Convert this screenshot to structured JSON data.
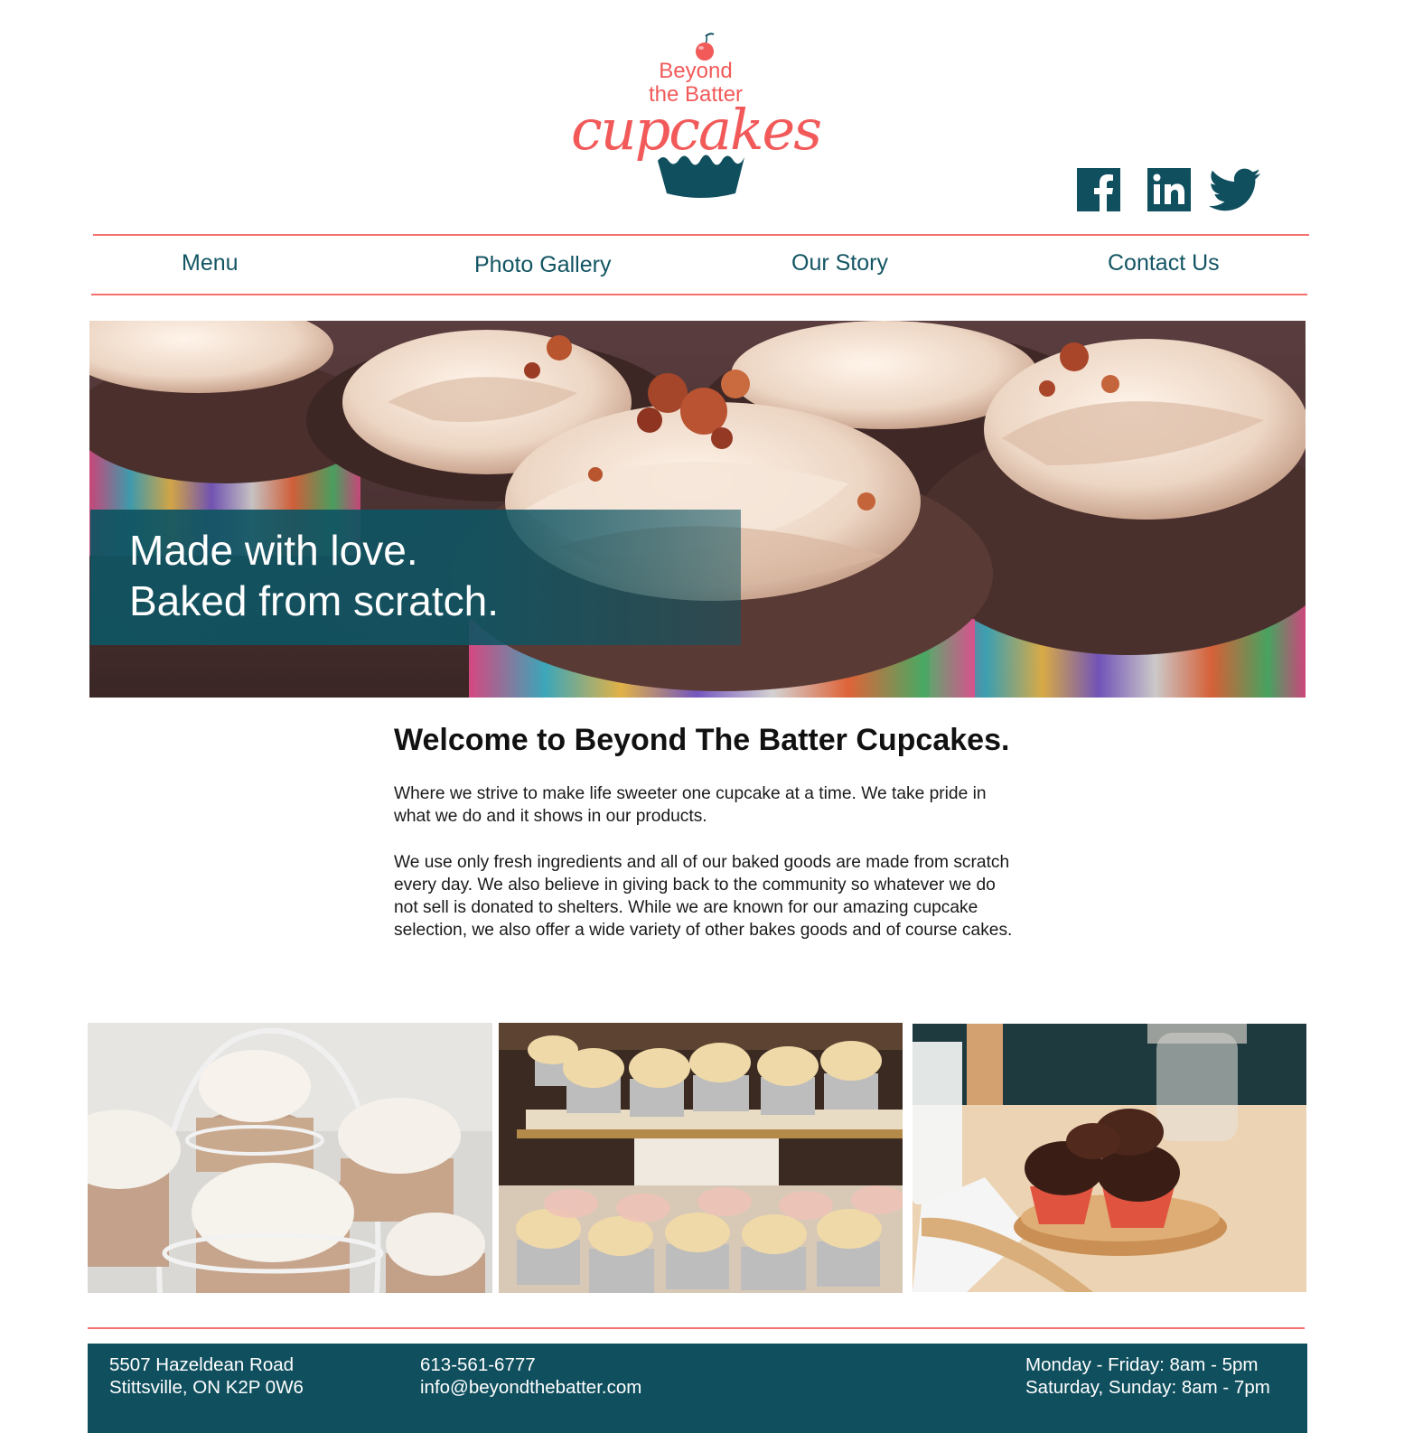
{
  "brand": {
    "logo_line1": "Beyond",
    "logo_line2": "the Batter",
    "logo_script": "cupcakes",
    "primary_color": "#f25a5a",
    "accent_color": "#135563"
  },
  "social": [
    {
      "icon": "facebook-icon"
    },
    {
      "icon": "linkedin-icon"
    },
    {
      "icon": "twitter-icon"
    }
  ],
  "nav": {
    "items": [
      {
        "label": "Menu"
      },
      {
        "label": "Photo Gallery"
      },
      {
        "label": "Our Story"
      },
      {
        "label": "Contact Us"
      }
    ]
  },
  "hero": {
    "line1": "Made with love.",
    "line2": "Baked from scratch."
  },
  "welcome": {
    "title": "Welcome to Beyond The Batter Cupcakes.",
    "paragraph1": "Where we strive to make life sweeter one cupcake at a time.  We take pride in what we do and it shows in our products.",
    "paragraph2": "We use only fresh ingredients and all of our baked goods are made from scratch every day.  We also believe in giving back to the community so whatever we do not sell is donated to shelters.  While we are known for our amazing cupcake selection, we also offer a wide variety of other bakes goods and of course cakes."
  },
  "footer": {
    "address_line1": "5507 Hazeldean Road",
    "address_line2": "Stittsville, ON K2P 0W6",
    "phone": "613-561-6777",
    "email": "info@beyondthebatter.com",
    "hours_line1": "Monday - Friday: 8am - 5pm",
    "hours_line2": "Saturday, Sunday: 8am - 7pm"
  }
}
